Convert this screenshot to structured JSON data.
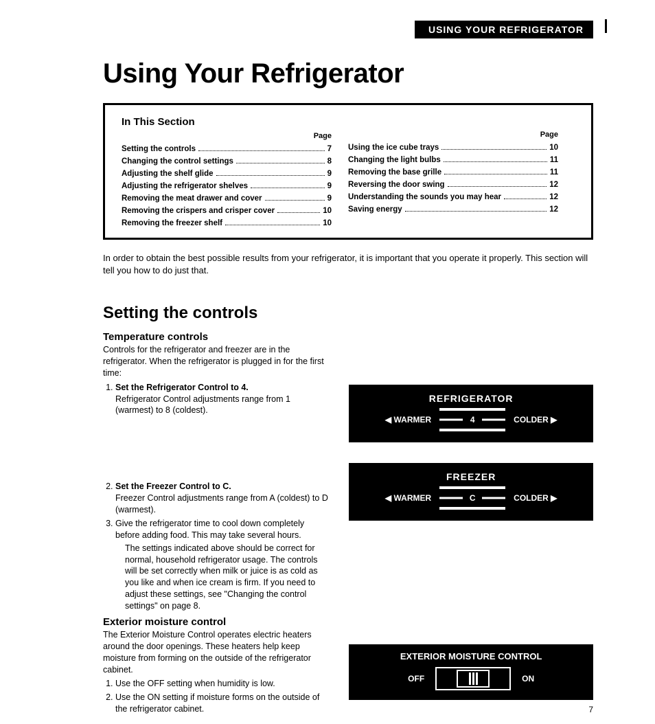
{
  "header_tab": "USING YOUR REFRIGERATOR",
  "main_title": "Using Your Refrigerator",
  "toc": {
    "heading": "In This Section",
    "page_label": "Page",
    "left": [
      {
        "title": "Setting the controls",
        "page": "7"
      },
      {
        "title": "Changing the control settings",
        "page": "8"
      },
      {
        "title": "Adjusting the shelf glide",
        "page": "9"
      },
      {
        "title": "Adjusting the refrigerator shelves",
        "page": "9"
      },
      {
        "title": "Removing the meat drawer and cover",
        "page": "9"
      },
      {
        "title": "Removing the crispers and crisper cover",
        "page": "10"
      },
      {
        "title": "Removing the freezer shelf",
        "page": "10"
      }
    ],
    "right": [
      {
        "title": "Using the ice cube trays",
        "page": "10"
      },
      {
        "title": "Changing the light bulbs",
        "page": "11"
      },
      {
        "title": "Removing the base grille",
        "page": "11"
      },
      {
        "title": "Reversing the door swing",
        "page": "12"
      },
      {
        "title": "Understanding the sounds you may hear",
        "page": "12"
      },
      {
        "title": "Saving energy",
        "page": "12"
      }
    ]
  },
  "intro": "In order to obtain the best possible results from your refrigerator, it is important that you operate it properly. This section will tell you how to do just that.",
  "section_title": "Setting the controls",
  "temp": {
    "heading": "Temperature controls",
    "lead": "Controls for the refrigerator and freezer are in the refrigerator. When the refrigerator is plugged in for the first time:",
    "step1_bold": "Set the Refrigerator Control to 4.",
    "step1_body": "Refrigerator Control adjustments range from 1 (warmest) to 8 (coldest).",
    "step2_bold": "Set the Freezer Control to C.",
    "step2_body": "Freezer Control adjustments range from A (coldest) to D (warmest).",
    "step3": "Give the refrigerator time to cool down completely before adding food. This may take several hours.",
    "note": "The settings indicated above should be correct for normal, household refrigerator usage. The controls will be set correctly when milk or juice is as cold as you like and when ice cream is firm. If you need to adjust these settings, see \"Changing the control settings\" on page 8."
  },
  "emc": {
    "heading": "Exterior moisture control",
    "lead": "The Exterior Moisture Control operates electric heaters around the door openings. These heaters help keep moisture from forming on the outside of the refrigerator cabinet.",
    "step1": "Use the OFF setting when humidity is low.",
    "step2": "Use the ON setting if moisture forms on the outside of the refrigerator cabinet."
  },
  "panels": {
    "refrigerator": {
      "title": "REFRIGERATOR",
      "warmer": "◀ WARMER",
      "value": "4",
      "colder": "COLDER ▶"
    },
    "freezer": {
      "title": "FREEZER",
      "warmer": "◀ WARMER",
      "value": "C",
      "colder": "COLDER ▶"
    },
    "emc": {
      "title": "EXTERIOR MOISTURE CONTROL",
      "off": "OFF",
      "on": "ON"
    }
  },
  "page_number": "7"
}
